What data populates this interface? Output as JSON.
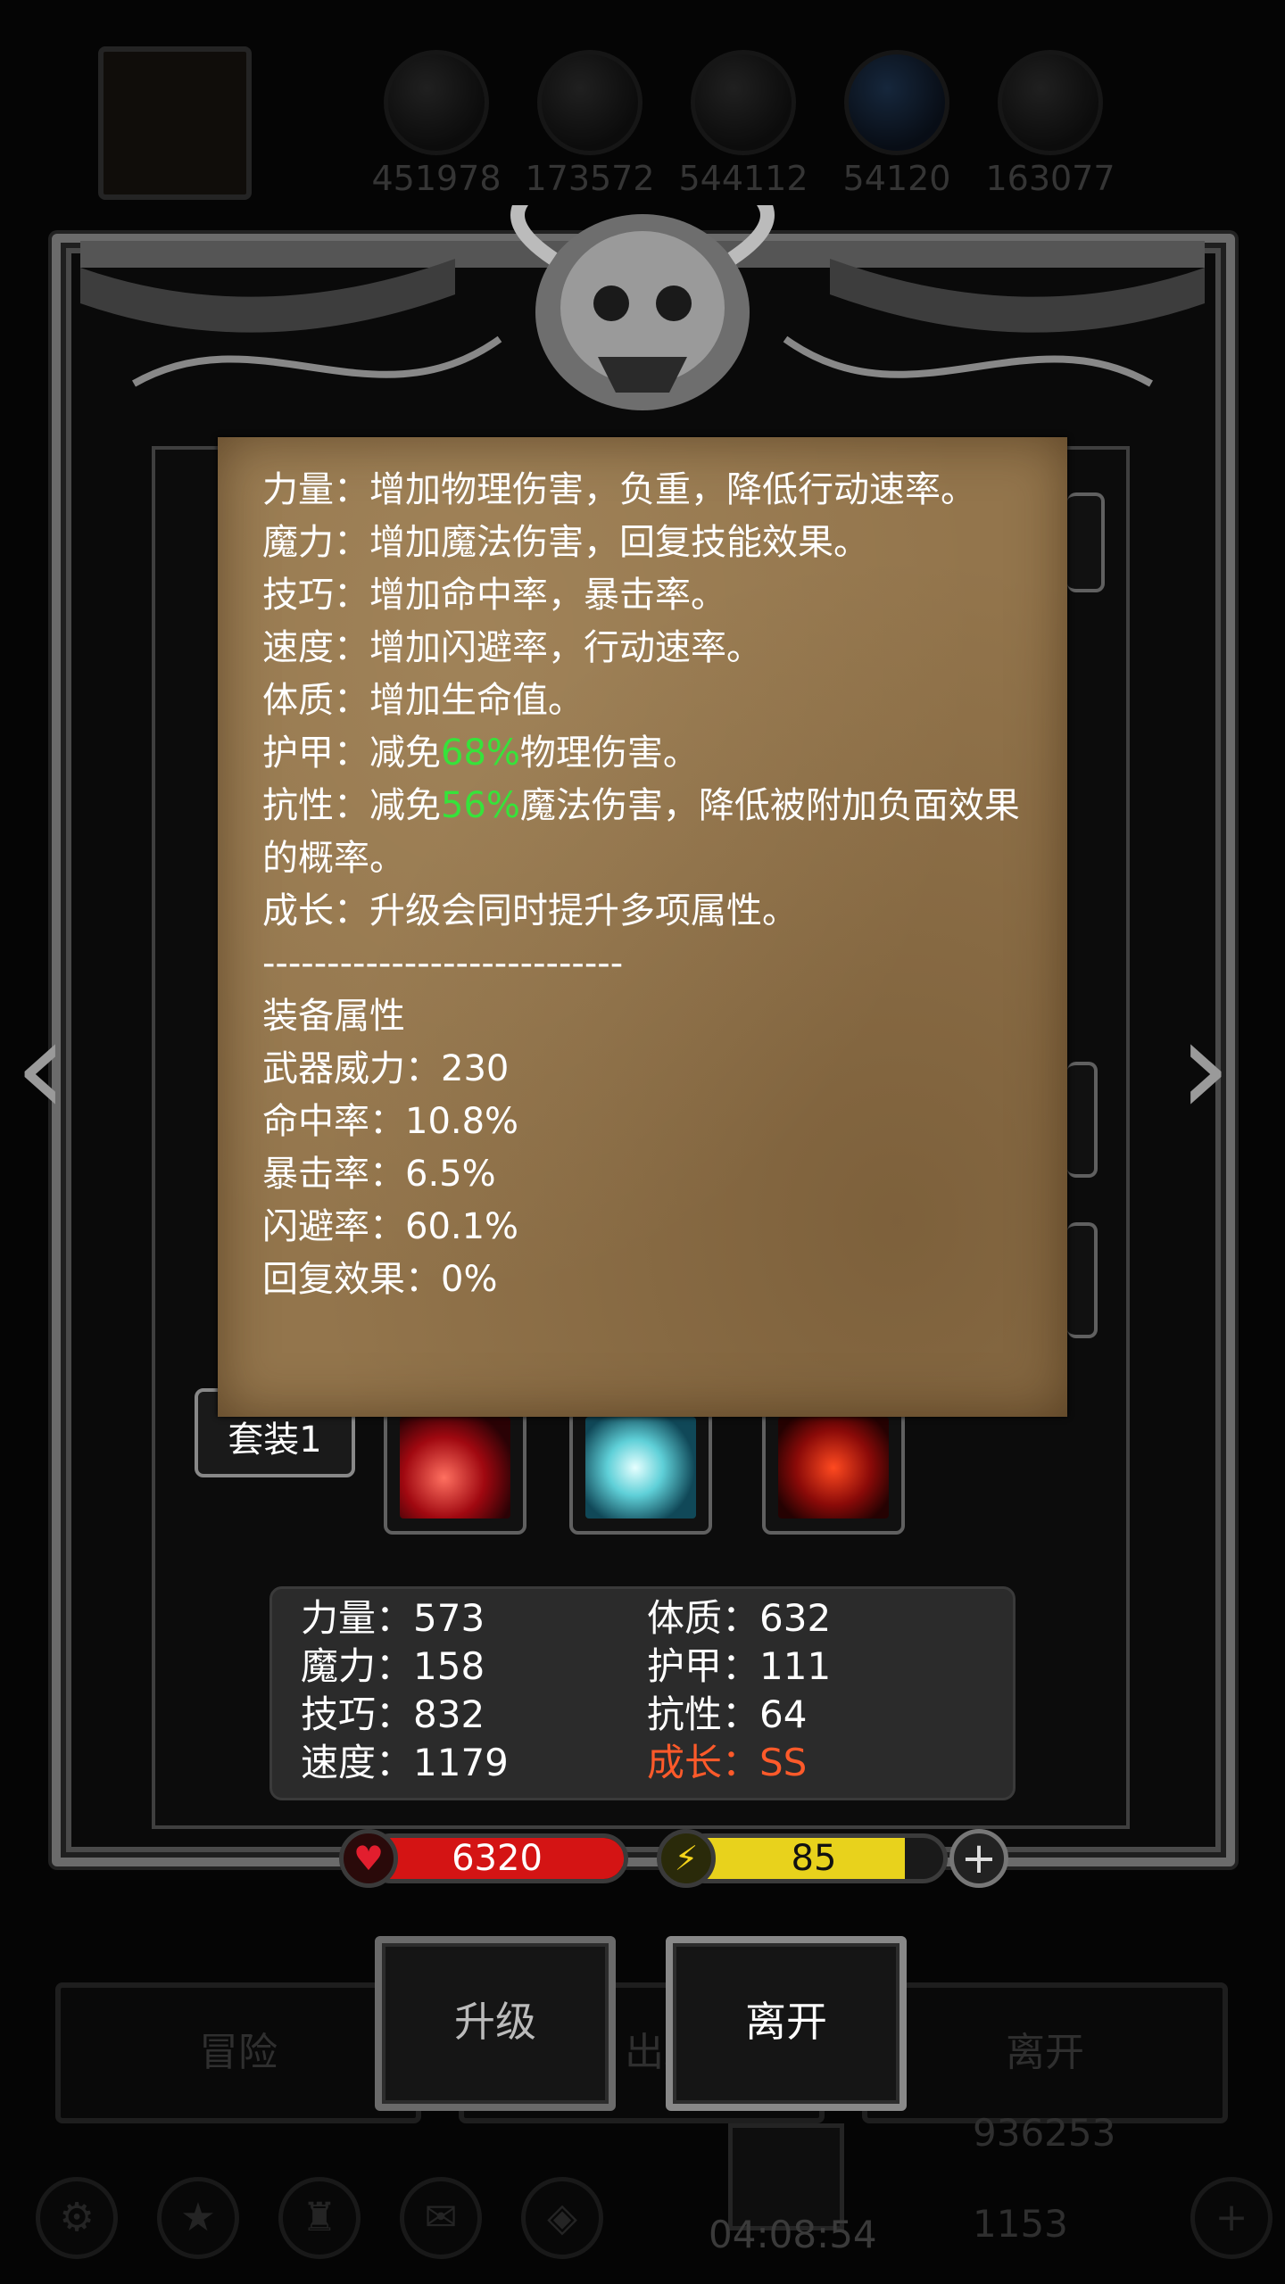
{
  "background": {
    "resources": [
      {
        "icon": "orange-meat-icon",
        "value": "451978"
      },
      {
        "icon": "wood-log-icon",
        "value": "173572"
      },
      {
        "icon": "stone-icon",
        "value": "544112"
      },
      {
        "icon": "blue-crystal-icon",
        "value": "54120"
      },
      {
        "icon": "iron-icon",
        "value": "163077"
      }
    ],
    "bottom_nav": {
      "adventure": "冒险",
      "depart": "出发",
      "leave": "离开"
    },
    "gold": "936253",
    "gems": "1153",
    "timer": "04:08:54"
  },
  "popup": {
    "lines": [
      {
        "pre": "力量：增加物理伤害，负重，降低行动速率。"
      },
      {
        "pre": "魔力：增加魔法伤害，回复技能效果。"
      },
      {
        "pre": "技巧：增加命中率，暴击率。"
      },
      {
        "pre": "速度：增加闪避率，行动速率。"
      },
      {
        "pre": "体质：增加生命值。"
      }
    ],
    "armor": {
      "pre": "护甲：减免",
      "value": "68%",
      "post": "物理伤害。"
    },
    "resist": {
      "pre": "抗性：减免",
      "value": "56%",
      "post": "魔法伤害，降低被附加负面效果的概率。"
    },
    "growth_line": "成长：升级会同时提升多项属性。",
    "divider": "----------------------------",
    "equip_title": "装备属性",
    "equip_lines": [
      "武器威力：230",
      "命中率：10.8%",
      "暴击率：6.5%",
      "闪避率：60.1%",
      "回复效果：0%"
    ]
  },
  "set_label": "套装1",
  "skills": [
    {
      "icon": "red-slash-skill-icon"
    },
    {
      "icon": "ice-whirl-skill-icon"
    },
    {
      "icon": "flame-blade-skill-icon"
    }
  ],
  "stats": {
    "left": [
      "力量：573",
      "魔力：158",
      "技巧：832",
      "速度：1179"
    ],
    "right": [
      "体质：632",
      "护甲：111",
      "抗性：64"
    ],
    "growth": "成长：SS"
  },
  "hp": {
    "value": "6320",
    "fill": 1.0,
    "color": "#d41414"
  },
  "energy": {
    "value": "85",
    "fill": 0.85,
    "color": "#e8d21c"
  },
  "buttons": {
    "upgrade": "升级",
    "leave": "离开"
  },
  "colors": {
    "green": "#36e33a",
    "orange": "#ff5a2a",
    "parchment": "#93754c"
  }
}
